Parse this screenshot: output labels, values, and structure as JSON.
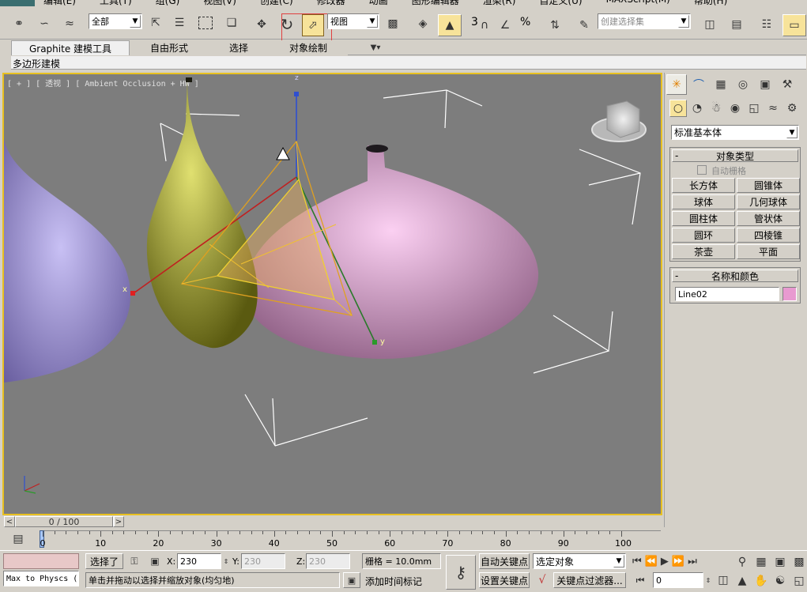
{
  "menu": [
    "编辑(E)",
    "工具(T)",
    "组(G)",
    "视图(V)",
    "创建(C)",
    "修改器",
    "动画",
    "图形编辑器",
    "渲染(R)",
    "自定义(U)",
    "MAXScript(M)",
    "帮助(H)"
  ],
  "toolbar": {
    "selection_filter": "全部",
    "ref_coord": "视图",
    "named_set_placeholder": "创建选择集",
    "snap_num": "3",
    "percent": "%"
  },
  "ribbon": {
    "tabs": [
      "Graphite 建模工具",
      "自由形式",
      "选择",
      "对象绘制"
    ],
    "subtab": "多边形建模"
  },
  "viewport": {
    "label": "[ + ] [ 透视 ] [ Ambient Occlusion + HW ]",
    "axis_x": "x",
    "axis_y": "y",
    "axis_z": "z"
  },
  "command_panel": {
    "category": "标准基本体",
    "rollout_object_type": "对象类型",
    "autogrid": "自动栅格",
    "buttons": [
      "长方体",
      "圆锥体",
      "球体",
      "几何球体",
      "圆柱体",
      "管状体",
      "圆环",
      "四棱锥",
      "茶壶",
      "平面"
    ],
    "rollout_name_color": "名称和颜色",
    "object_name": "Line02",
    "object_color": "#e89ad0"
  },
  "timeline": {
    "frame": "0 / 100",
    "ticks": [
      "0",
      "10",
      "20",
      "30",
      "40",
      "50",
      "60",
      "70",
      "80",
      "90",
      "100"
    ]
  },
  "status": {
    "maxscript": "Max to Physcs (",
    "selected": "选择了",
    "x_label": "X:",
    "x_value": "230",
    "y_label": "Y:",
    "y_value": "230",
    "z_label": "Z:",
    "z_value": "230",
    "grid": "栅格 = 10.0mm",
    "auto_key": "自动关键点",
    "key_mode": "选定对象",
    "set_key": "设置关键点",
    "key_filter": "关键点过滤器...",
    "frame_value": "0",
    "prompt": "单击并拖动以选择并缩放对象(均匀地)",
    "add_time_tag": "添加时间标记"
  }
}
